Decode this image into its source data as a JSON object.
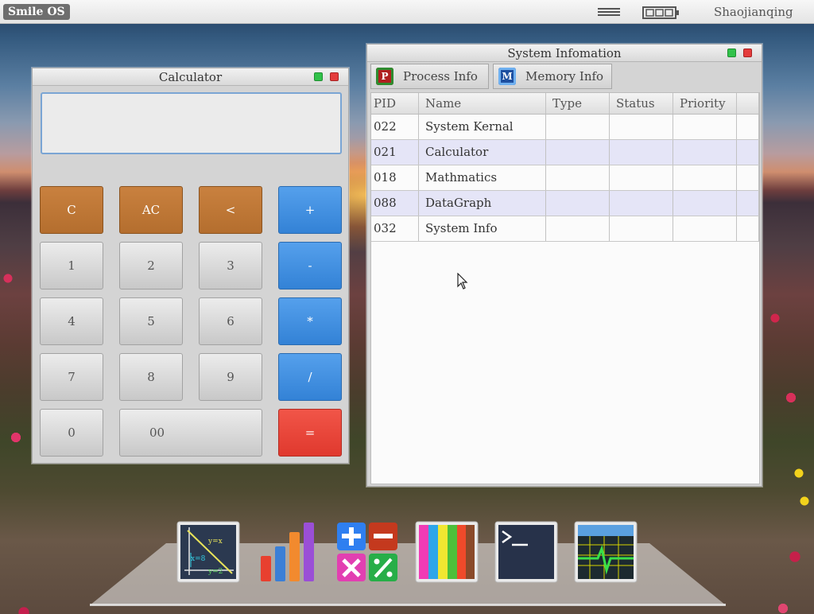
{
  "topbar": {
    "os_name": "Smile OS",
    "menu_icon": "hamburger-menu-icon",
    "battery_icon": "battery-icon",
    "user": "Shaojianqing"
  },
  "calculator": {
    "title": "Calculator",
    "display_value": "",
    "keys": {
      "clear": "C",
      "all_clear": "AC",
      "backspace": "<",
      "plus": "+",
      "one": "1",
      "two": "2",
      "three": "3",
      "minus": "-",
      "four": "4",
      "five": "5",
      "six": "6",
      "multiply": "*",
      "seven": "7",
      "eight": "8",
      "nine": "9",
      "divide": "/",
      "zero": "0",
      "double_zero": "00",
      "equals": "="
    }
  },
  "sysinfo": {
    "title": "System Infomation",
    "tabs": {
      "process": "Process Info",
      "process_icon_letter": "P",
      "memory": "Memory Info",
      "memory_icon_letter": "M"
    },
    "columns": [
      "PID",
      "Name",
      "Type",
      "Status",
      "Priority"
    ],
    "rows": [
      {
        "pid": "022",
        "name": "System Kernal",
        "type": "",
        "status": "",
        "priority": ""
      },
      {
        "pid": "021",
        "name": "Calculator",
        "type": "",
        "status": "",
        "priority": ""
      },
      {
        "pid": "018",
        "name": "Mathmatics",
        "type": "",
        "status": "",
        "priority": ""
      },
      {
        "pid": "088",
        "name": "DataGraph",
        "type": "",
        "status": "",
        "priority": ""
      },
      {
        "pid": "032",
        "name": "System Info",
        "type": "",
        "status": "",
        "priority": ""
      }
    ]
  },
  "dock": {
    "items": [
      {
        "icon": "mathematics-graph-icon"
      },
      {
        "icon": "bar-chart-icon"
      },
      {
        "icon": "calculator-operators-icon"
      },
      {
        "icon": "color-palette-icon"
      },
      {
        "icon": "terminal-icon"
      },
      {
        "icon": "system-monitor-icon"
      }
    ]
  },
  "colors": {
    "orange_key": "#c27a39",
    "blue_key": "#4592e2",
    "red_key": "#e8473b",
    "selected_row": "#e5e5f7"
  }
}
